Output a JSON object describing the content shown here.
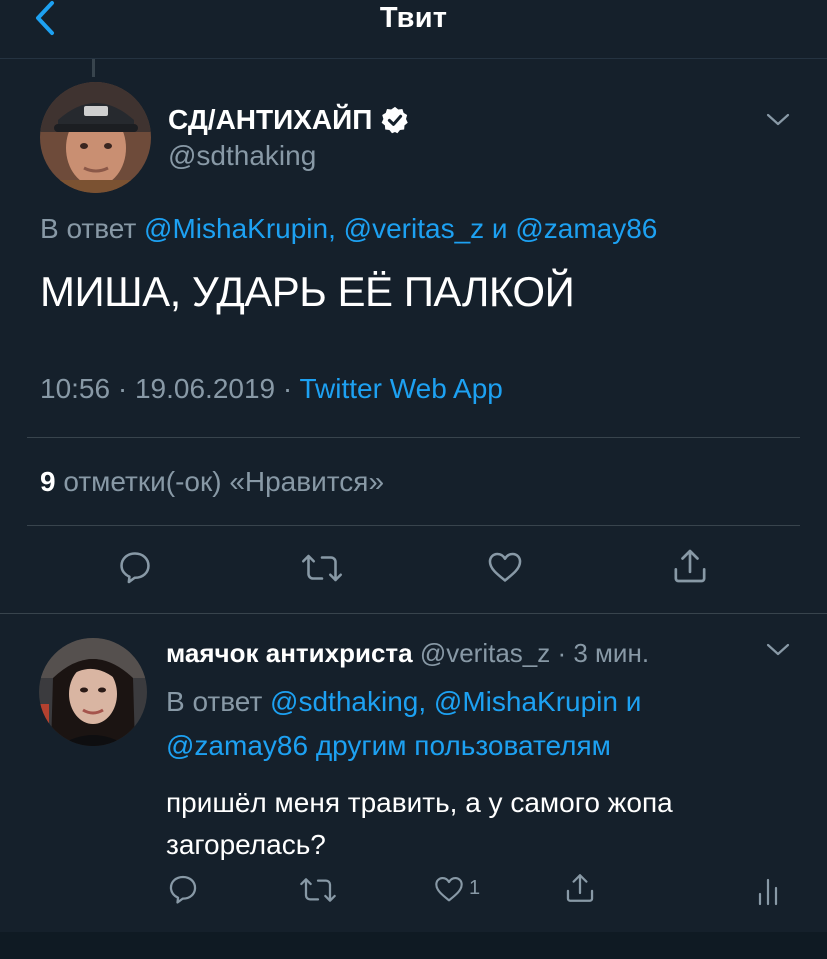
{
  "header": {
    "title": "Твит",
    "back_icon": "chevron-left-icon"
  },
  "tweet": {
    "display_name": "СД/АНТИХАЙП",
    "verified_icon": "verified-badge-icon",
    "handle": "@sdthaking",
    "reply_prefix": "В ответ ",
    "reply_to": [
      {
        "text": "@MishaKrupin"
      },
      {
        "sep": ", "
      },
      {
        "text": "@veritas_z"
      },
      {
        "sep": " и "
      },
      {
        "text": "@zamay86"
      }
    ],
    "reply_mentions": [
      "@MishaKrupin",
      "@veritas_z",
      "@zamay86"
    ],
    "reply_sep1": ", ",
    "reply_sep2": " и ",
    "text": "МИША, УДАРЬ ЕЁ ПАЛКОЙ",
    "time": "10:56",
    "dot": " · ",
    "date": "19.06.2019",
    "source": "Twitter Web App",
    "likes_count": "9",
    "likes_label": " отметки(-ок) «Нравится»",
    "actions": [
      "reply-icon",
      "retweet-icon",
      "like-icon",
      "share-icon"
    ]
  },
  "reply": {
    "display_name": "маячок антихриста",
    "handle": "@veritas_z",
    "dot": " · ",
    "time": "3 мин.",
    "reply_prefix": "В ответ ",
    "mention1": "@sdthaking",
    "sep1": ", ",
    "mention2": "@MishaKrupin",
    "sep2": " и ",
    "mention3": "@zamay86",
    "others": " другим пользователям",
    "text": "пришёл меня травить, а у самого жопа загорелась?",
    "like_count": "1",
    "actions": [
      "reply-icon",
      "retweet-icon",
      "like-icon",
      "share-icon",
      "analytics-icon"
    ]
  },
  "colors": {
    "background": "#15202b",
    "accent": "#1da1f2",
    "muted": "#8899a6",
    "divider": "#38444d"
  }
}
